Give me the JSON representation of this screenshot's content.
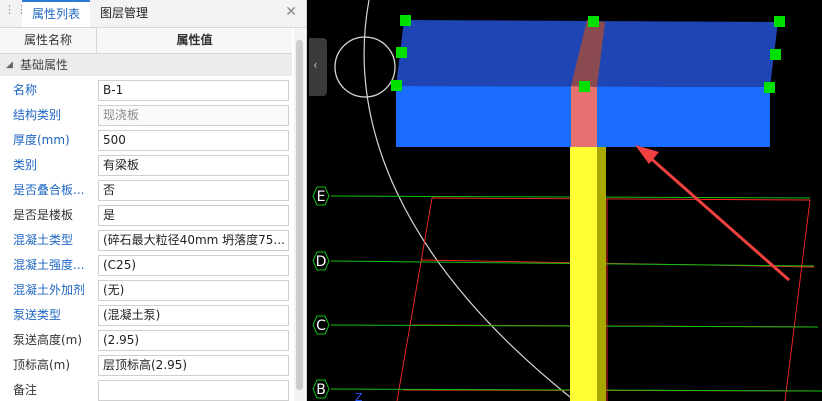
{
  "tabs": [
    {
      "label": "属性列表",
      "active": true
    },
    {
      "label": "图层管理",
      "active": false
    }
  ],
  "header": {
    "name_col": "属性名称",
    "value_col": "属性值"
  },
  "section": {
    "label": "基础属性"
  },
  "properties": [
    {
      "name": "名称",
      "value": "B-1",
      "highlight": true,
      "disabled": false
    },
    {
      "name": "结构类别",
      "value": "现浇板",
      "highlight": true,
      "disabled": true
    },
    {
      "name": "厚度(mm)",
      "value": "500",
      "highlight": true,
      "disabled": false
    },
    {
      "name": "类别",
      "value": "有梁板",
      "highlight": true,
      "disabled": false
    },
    {
      "name": "是否叠合板...",
      "value": "否",
      "highlight": true,
      "disabled": false
    },
    {
      "name": "是否是楼板",
      "value": "是",
      "highlight": false,
      "disabled": false
    },
    {
      "name": "混凝土类型",
      "value": "(碎石最大粒径40mm 坍落度75...",
      "highlight": true,
      "disabled": false
    },
    {
      "name": "混凝土强度...",
      "value": "(C25)",
      "highlight": true,
      "disabled": false
    },
    {
      "name": "混凝土外加剂",
      "value": "(无)",
      "highlight": true,
      "disabled": false
    },
    {
      "name": "泵送类型",
      "value": "(混凝土泵)",
      "highlight": true,
      "disabled": false
    },
    {
      "name": "泵送高度(m)",
      "value": "(2.95)",
      "highlight": false,
      "disabled": false
    },
    {
      "name": "顶标高(m)",
      "value": "层顶标高(2.95)",
      "highlight": false,
      "disabled": false
    },
    {
      "name": "备注",
      "value": "",
      "highlight": false,
      "disabled": false
    }
  ],
  "axis_labels": [
    "E",
    "D",
    "C",
    "B"
  ],
  "axis_z_label": "Z",
  "colors": {
    "slab_top": "#1f44b4",
    "slab_front": "#1a6cff",
    "beam_top": "#8b4a50",
    "beam_front": "#e87070",
    "column": "#ffff33",
    "column_side": "#a8a800",
    "grip": "#00e000",
    "gridline": "#ff2a2a",
    "axisline": "#11c011",
    "arrow": "#f04040"
  }
}
